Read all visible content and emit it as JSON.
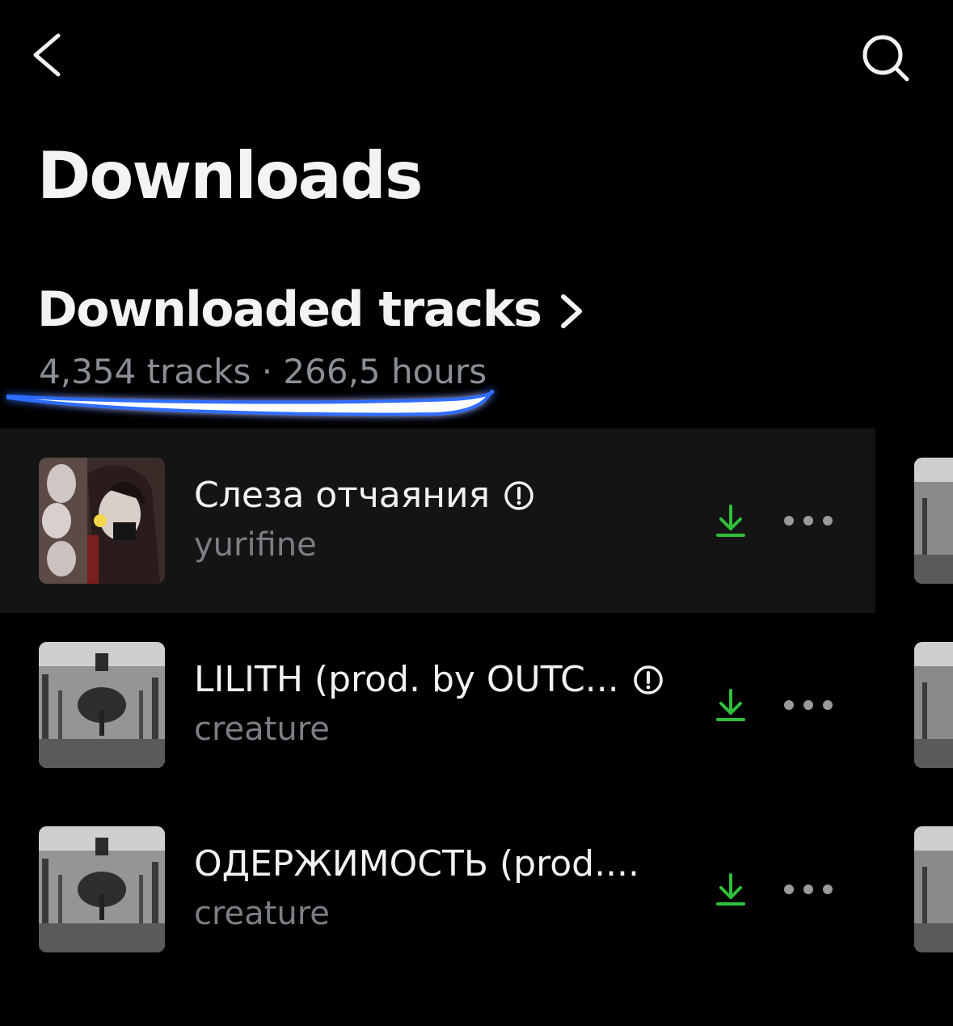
{
  "header": {
    "back_icon": "chevron-left-icon",
    "search_icon": "search-icon"
  },
  "page": {
    "title": "Downloads"
  },
  "section": {
    "title": "Downloaded tracks",
    "chevron_icon": "chevron-right-icon",
    "subtitle": "4,354 tracks · 266,5 hours"
  },
  "tracks": [
    {
      "title": "Слеза отчаяния",
      "artist": "yurifine",
      "explicit": true,
      "downloaded": true
    },
    {
      "title": "LILITH (prod. by OUTC...",
      "artist": "creature",
      "explicit": true,
      "downloaded": true
    },
    {
      "title": "ОДЕРЖИМОСТЬ (prod....",
      "artist": "creature",
      "explicit": false,
      "downloaded": true
    }
  ],
  "colors": {
    "background": "#000000",
    "active_row": "#141414",
    "download_accent": "#2fbf3a",
    "highlight_stroke": "#ffffff",
    "highlight_glow": "#2f6dff"
  }
}
